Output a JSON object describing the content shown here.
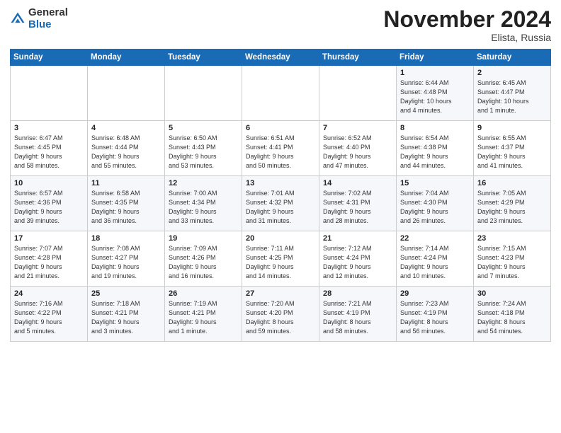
{
  "header": {
    "logo_general": "General",
    "logo_blue": "Blue",
    "month_title": "November 2024",
    "location": "Elista, Russia"
  },
  "weekdays": [
    "Sunday",
    "Monday",
    "Tuesday",
    "Wednesday",
    "Thursday",
    "Friday",
    "Saturday"
  ],
  "weeks": [
    [
      {
        "day": "",
        "info": ""
      },
      {
        "day": "",
        "info": ""
      },
      {
        "day": "",
        "info": ""
      },
      {
        "day": "",
        "info": ""
      },
      {
        "day": "",
        "info": ""
      },
      {
        "day": "1",
        "info": "Sunrise: 6:44 AM\nSunset: 4:48 PM\nDaylight: 10 hours\nand 4 minutes."
      },
      {
        "day": "2",
        "info": "Sunrise: 6:45 AM\nSunset: 4:47 PM\nDaylight: 10 hours\nand 1 minute."
      }
    ],
    [
      {
        "day": "3",
        "info": "Sunrise: 6:47 AM\nSunset: 4:45 PM\nDaylight: 9 hours\nand 58 minutes."
      },
      {
        "day": "4",
        "info": "Sunrise: 6:48 AM\nSunset: 4:44 PM\nDaylight: 9 hours\nand 55 minutes."
      },
      {
        "day": "5",
        "info": "Sunrise: 6:50 AM\nSunset: 4:43 PM\nDaylight: 9 hours\nand 53 minutes."
      },
      {
        "day": "6",
        "info": "Sunrise: 6:51 AM\nSunset: 4:41 PM\nDaylight: 9 hours\nand 50 minutes."
      },
      {
        "day": "7",
        "info": "Sunrise: 6:52 AM\nSunset: 4:40 PM\nDaylight: 9 hours\nand 47 minutes."
      },
      {
        "day": "8",
        "info": "Sunrise: 6:54 AM\nSunset: 4:38 PM\nDaylight: 9 hours\nand 44 minutes."
      },
      {
        "day": "9",
        "info": "Sunrise: 6:55 AM\nSunset: 4:37 PM\nDaylight: 9 hours\nand 41 minutes."
      }
    ],
    [
      {
        "day": "10",
        "info": "Sunrise: 6:57 AM\nSunset: 4:36 PM\nDaylight: 9 hours\nand 39 minutes."
      },
      {
        "day": "11",
        "info": "Sunrise: 6:58 AM\nSunset: 4:35 PM\nDaylight: 9 hours\nand 36 minutes."
      },
      {
        "day": "12",
        "info": "Sunrise: 7:00 AM\nSunset: 4:34 PM\nDaylight: 9 hours\nand 33 minutes."
      },
      {
        "day": "13",
        "info": "Sunrise: 7:01 AM\nSunset: 4:32 PM\nDaylight: 9 hours\nand 31 minutes."
      },
      {
        "day": "14",
        "info": "Sunrise: 7:02 AM\nSunset: 4:31 PM\nDaylight: 9 hours\nand 28 minutes."
      },
      {
        "day": "15",
        "info": "Sunrise: 7:04 AM\nSunset: 4:30 PM\nDaylight: 9 hours\nand 26 minutes."
      },
      {
        "day": "16",
        "info": "Sunrise: 7:05 AM\nSunset: 4:29 PM\nDaylight: 9 hours\nand 23 minutes."
      }
    ],
    [
      {
        "day": "17",
        "info": "Sunrise: 7:07 AM\nSunset: 4:28 PM\nDaylight: 9 hours\nand 21 minutes."
      },
      {
        "day": "18",
        "info": "Sunrise: 7:08 AM\nSunset: 4:27 PM\nDaylight: 9 hours\nand 19 minutes."
      },
      {
        "day": "19",
        "info": "Sunrise: 7:09 AM\nSunset: 4:26 PM\nDaylight: 9 hours\nand 16 minutes."
      },
      {
        "day": "20",
        "info": "Sunrise: 7:11 AM\nSunset: 4:25 PM\nDaylight: 9 hours\nand 14 minutes."
      },
      {
        "day": "21",
        "info": "Sunrise: 7:12 AM\nSunset: 4:24 PM\nDaylight: 9 hours\nand 12 minutes."
      },
      {
        "day": "22",
        "info": "Sunrise: 7:14 AM\nSunset: 4:24 PM\nDaylight: 9 hours\nand 10 minutes."
      },
      {
        "day": "23",
        "info": "Sunrise: 7:15 AM\nSunset: 4:23 PM\nDaylight: 9 hours\nand 7 minutes."
      }
    ],
    [
      {
        "day": "24",
        "info": "Sunrise: 7:16 AM\nSunset: 4:22 PM\nDaylight: 9 hours\nand 5 minutes."
      },
      {
        "day": "25",
        "info": "Sunrise: 7:18 AM\nSunset: 4:21 PM\nDaylight: 9 hours\nand 3 minutes."
      },
      {
        "day": "26",
        "info": "Sunrise: 7:19 AM\nSunset: 4:21 PM\nDaylight: 9 hours\nand 1 minute."
      },
      {
        "day": "27",
        "info": "Sunrise: 7:20 AM\nSunset: 4:20 PM\nDaylight: 8 hours\nand 59 minutes."
      },
      {
        "day": "28",
        "info": "Sunrise: 7:21 AM\nSunset: 4:19 PM\nDaylight: 8 hours\nand 58 minutes."
      },
      {
        "day": "29",
        "info": "Sunrise: 7:23 AM\nSunset: 4:19 PM\nDaylight: 8 hours\nand 56 minutes."
      },
      {
        "day": "30",
        "info": "Sunrise: 7:24 AM\nSunset: 4:18 PM\nDaylight: 8 hours\nand 54 minutes."
      }
    ]
  ]
}
